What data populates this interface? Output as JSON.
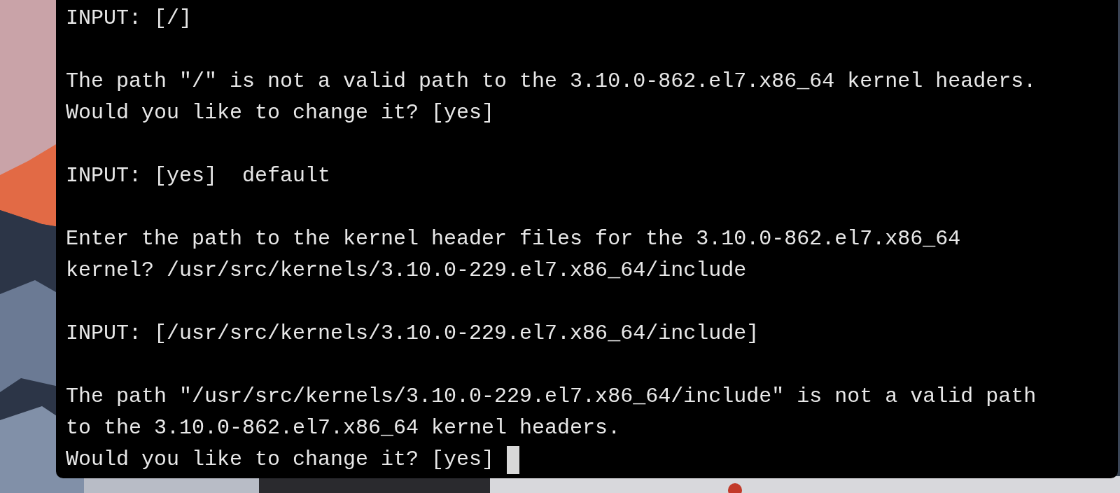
{
  "terminal": {
    "lines": [
      {
        "kind": "text",
        "text": "INPUT: [/]"
      },
      {
        "kind": "blank"
      },
      {
        "kind": "text",
        "text": "The path \"/\" is not a valid path to the 3.10.0-862.el7.x86_64 kernel headers."
      },
      {
        "kind": "text",
        "text": "Would you like to change it? [yes]"
      },
      {
        "kind": "blank"
      },
      {
        "kind": "text",
        "text": "INPUT: [yes]  default"
      },
      {
        "kind": "blank"
      },
      {
        "kind": "text",
        "text": "Enter the path to the kernel header files for the 3.10.0-862.el7.x86_64"
      },
      {
        "kind": "text",
        "text": "kernel? /usr/src/kernels/3.10.0-229.el7.x86_64/include"
      },
      {
        "kind": "blank"
      },
      {
        "kind": "text",
        "text": "INPUT: [/usr/src/kernels/3.10.0-229.el7.x86_64/include]"
      },
      {
        "kind": "blank"
      },
      {
        "kind": "text",
        "text": "The path \"/usr/src/kernels/3.10.0-229.el7.x86_64/include\" is not a valid path"
      },
      {
        "kind": "text",
        "text": "to the 3.10.0-862.el7.x86_64 kernel headers."
      },
      {
        "kind": "text",
        "text": "Would you like to change it? [yes]",
        "cursor": true
      }
    ]
  }
}
